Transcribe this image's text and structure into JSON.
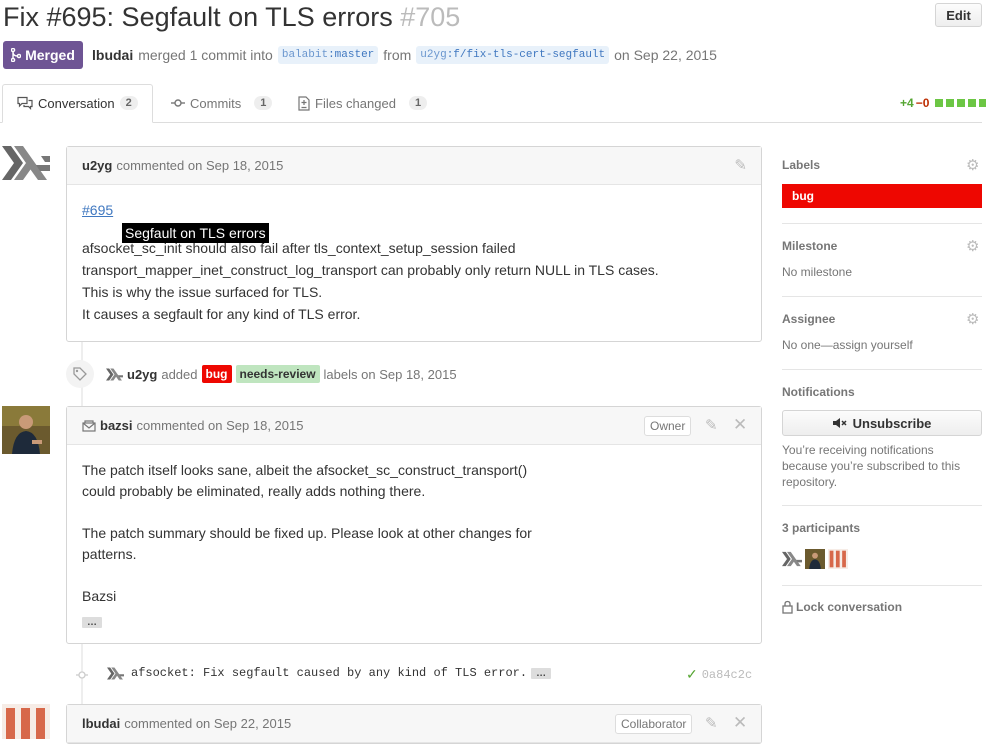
{
  "pr": {
    "title": "Fix #695: Segfault on TLS errors",
    "number": "#705",
    "edit_label": "Edit",
    "state_label": "Merged",
    "author": "lbudai",
    "merge_text": "merged 1 commit into",
    "base_repo": "balabit",
    "base_branch": "master",
    "from_text": "from",
    "head_repo": "u2yg",
    "head_branch": "f/fix-tls-cert-segfault",
    "date_text": "on Sep 22, 2015"
  },
  "tabs": [
    {
      "label": "Conversation",
      "count": "2",
      "icon": "comment-discussion-icon"
    },
    {
      "label": "Commits",
      "count": "1",
      "icon": "git-commit-icon"
    },
    {
      "label": "Files changed",
      "count": "1",
      "icon": "diff-icon"
    }
  ],
  "diffstat": {
    "additions": "+4",
    "deletions": "−0",
    "colors": [
      "#6cc644",
      "#6cc644",
      "#6cc644",
      "#6cc644",
      "#6cc644"
    ]
  },
  "comments": [
    {
      "author": "u2yg",
      "meta": "commented on Sep 18, 2015",
      "link": "#695",
      "tooltip": "Segfault on TLS errors",
      "lines": [
        "afsocket_sc_init should also fail after tls_context_setup_session failed",
        "transport_mapper_inet_construct_log_transport can probably only return NULL in TLS cases.",
        "This is why the issue surfaced for TLS.",
        "It causes a segfault for any kind of TLS error."
      ]
    },
    {
      "author": "bazsi",
      "meta": "commented on Sep 18, 2015",
      "role": "Owner",
      "lines": [
        "The patch itself looks sane, albeit the afsocket_sc_construct_transport()",
        "could probably be eliminated, really adds nothing there.",
        "",
        "The patch summary should be fixed up. Please look at other changes for",
        "patterns.",
        "",
        "Bazsi"
      ],
      "ellipsis": "…"
    },
    {
      "author": "lbudai",
      "meta": "commented on Sep 22, 2015",
      "role": "Collaborator"
    }
  ],
  "label_event": {
    "actor": "u2yg",
    "action": "added",
    "labels": [
      {
        "name": "bug",
        "bg": "#ee0701",
        "fg": "#ffffff"
      },
      {
        "name": "needs-review",
        "bg": "#bfe5bf",
        "fg": "#333333"
      }
    ],
    "suffix": "labels on Sep 18, 2015"
  },
  "commit_event": {
    "message": "afsocket: Fix segfault caused by any kind of TLS error.",
    "ellipsis": "…",
    "sha": "0a84c2c"
  },
  "sidebar": {
    "labels_title": "Labels",
    "label": {
      "name": "bug",
      "bg": "#ee0701"
    },
    "milestone_title": "Milestone",
    "milestone_value": "No milestone",
    "assignee_title": "Assignee",
    "assignee_value": "No one—assign yourself",
    "notifications_title": "Notifications",
    "unsubscribe_label": "Unsubscribe",
    "notifications_text": "You’re receiving notifications because you’re subscribed to this repository.",
    "participants_title": "3 participants",
    "lock_label": "Lock conversation"
  },
  "colors": {
    "merged": "#6e5494",
    "link": "#4078c0",
    "success": "#55a532"
  }
}
